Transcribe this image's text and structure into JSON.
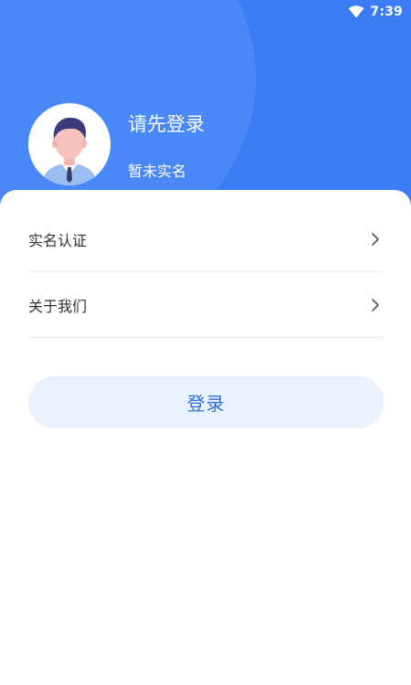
{
  "status_bar": {
    "time": "7:39",
    "wifi_icon": "wifi-icon"
  },
  "profile": {
    "name": "请先登录",
    "verification_status": "暂未实名",
    "avatar_icon": "user-avatar-icon"
  },
  "menu": {
    "items": [
      {
        "label": "实名认证",
        "icon": "chevron-right-icon"
      },
      {
        "label": "关于我们",
        "icon": "chevron-right-icon"
      }
    ]
  },
  "actions": {
    "login_label": "登录"
  },
  "colors": {
    "header_blue": "#3b7cf5",
    "header_circle": "#4a88f7",
    "button_bg": "#e8f1fd",
    "button_text": "#2f6fd9"
  }
}
